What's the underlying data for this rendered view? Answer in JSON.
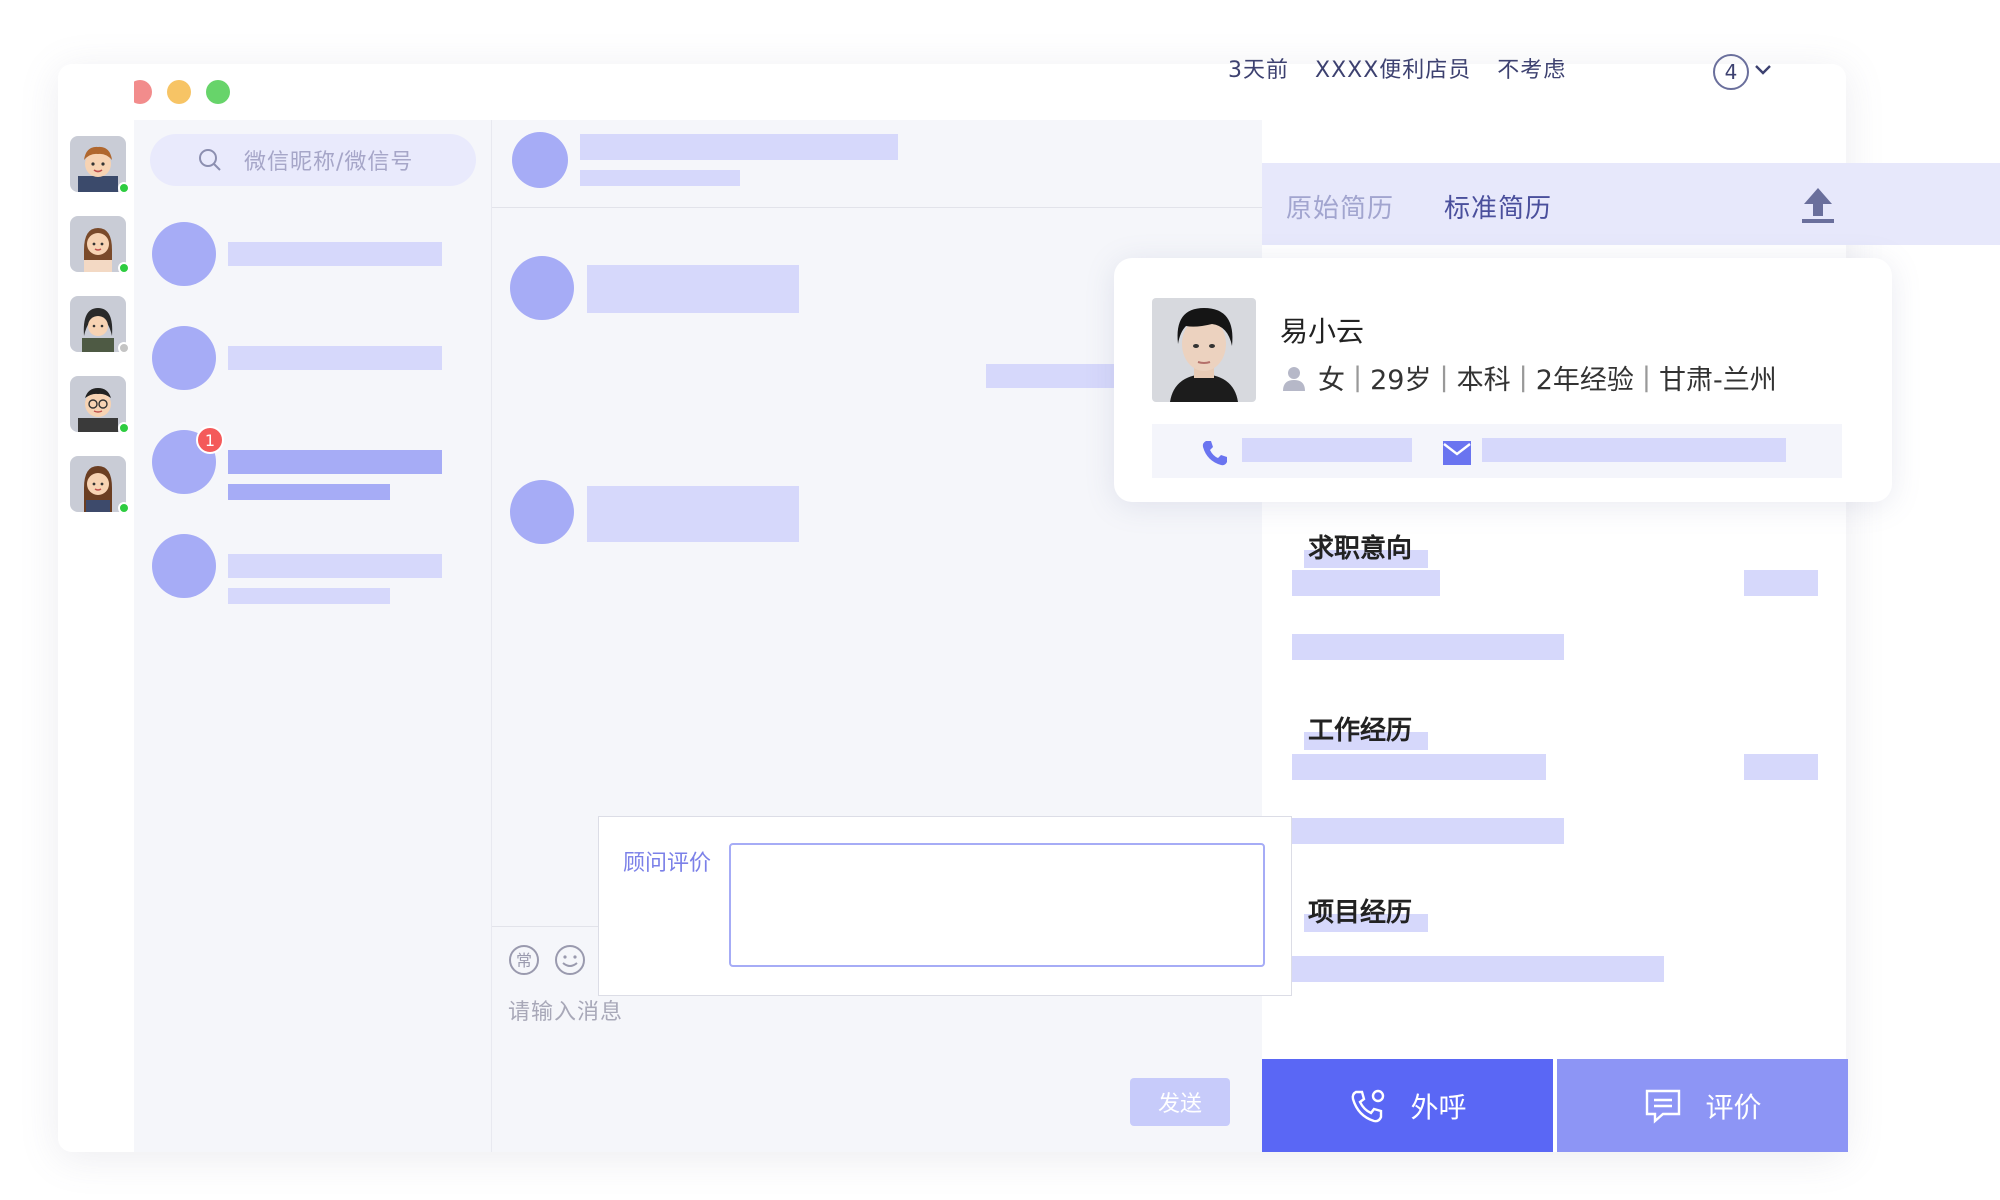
{
  "search": {
    "placeholder": "微信昵称/微信号"
  },
  "conversations": [
    {
      "unread_badge": ""
    },
    {
      "unread_badge": ""
    },
    {
      "unread_badge": "1"
    },
    {
      "unread_badge": ""
    }
  ],
  "chat": {
    "input_placeholder": "请输入消息",
    "send_label": "发送",
    "evaluation_label": "顾问评价"
  },
  "candidate": {
    "meta_time": "3天前",
    "meta_position": "XXXX便利店员",
    "meta_status": "不考虑",
    "count": "4",
    "tabs": {
      "original": "原始简历",
      "standard": "标准简历"
    },
    "name": "易小云",
    "gender": "女",
    "age": "29岁",
    "education": "本科",
    "experience": "2年经验",
    "location": "甘肃-兰州"
  },
  "sections": {
    "job_intent": "求职意向",
    "work_experience": "工作经历",
    "project_experience": "项目经历"
  },
  "actions": {
    "call_label": "外呼",
    "rate_label": "评价"
  },
  "colors": {
    "accent": "#5a67f5",
    "accent_light": "#a6acf6",
    "placeholder_bar": "#d6d8fb",
    "badge": "#f45a5a",
    "online": "#2ecc40"
  }
}
